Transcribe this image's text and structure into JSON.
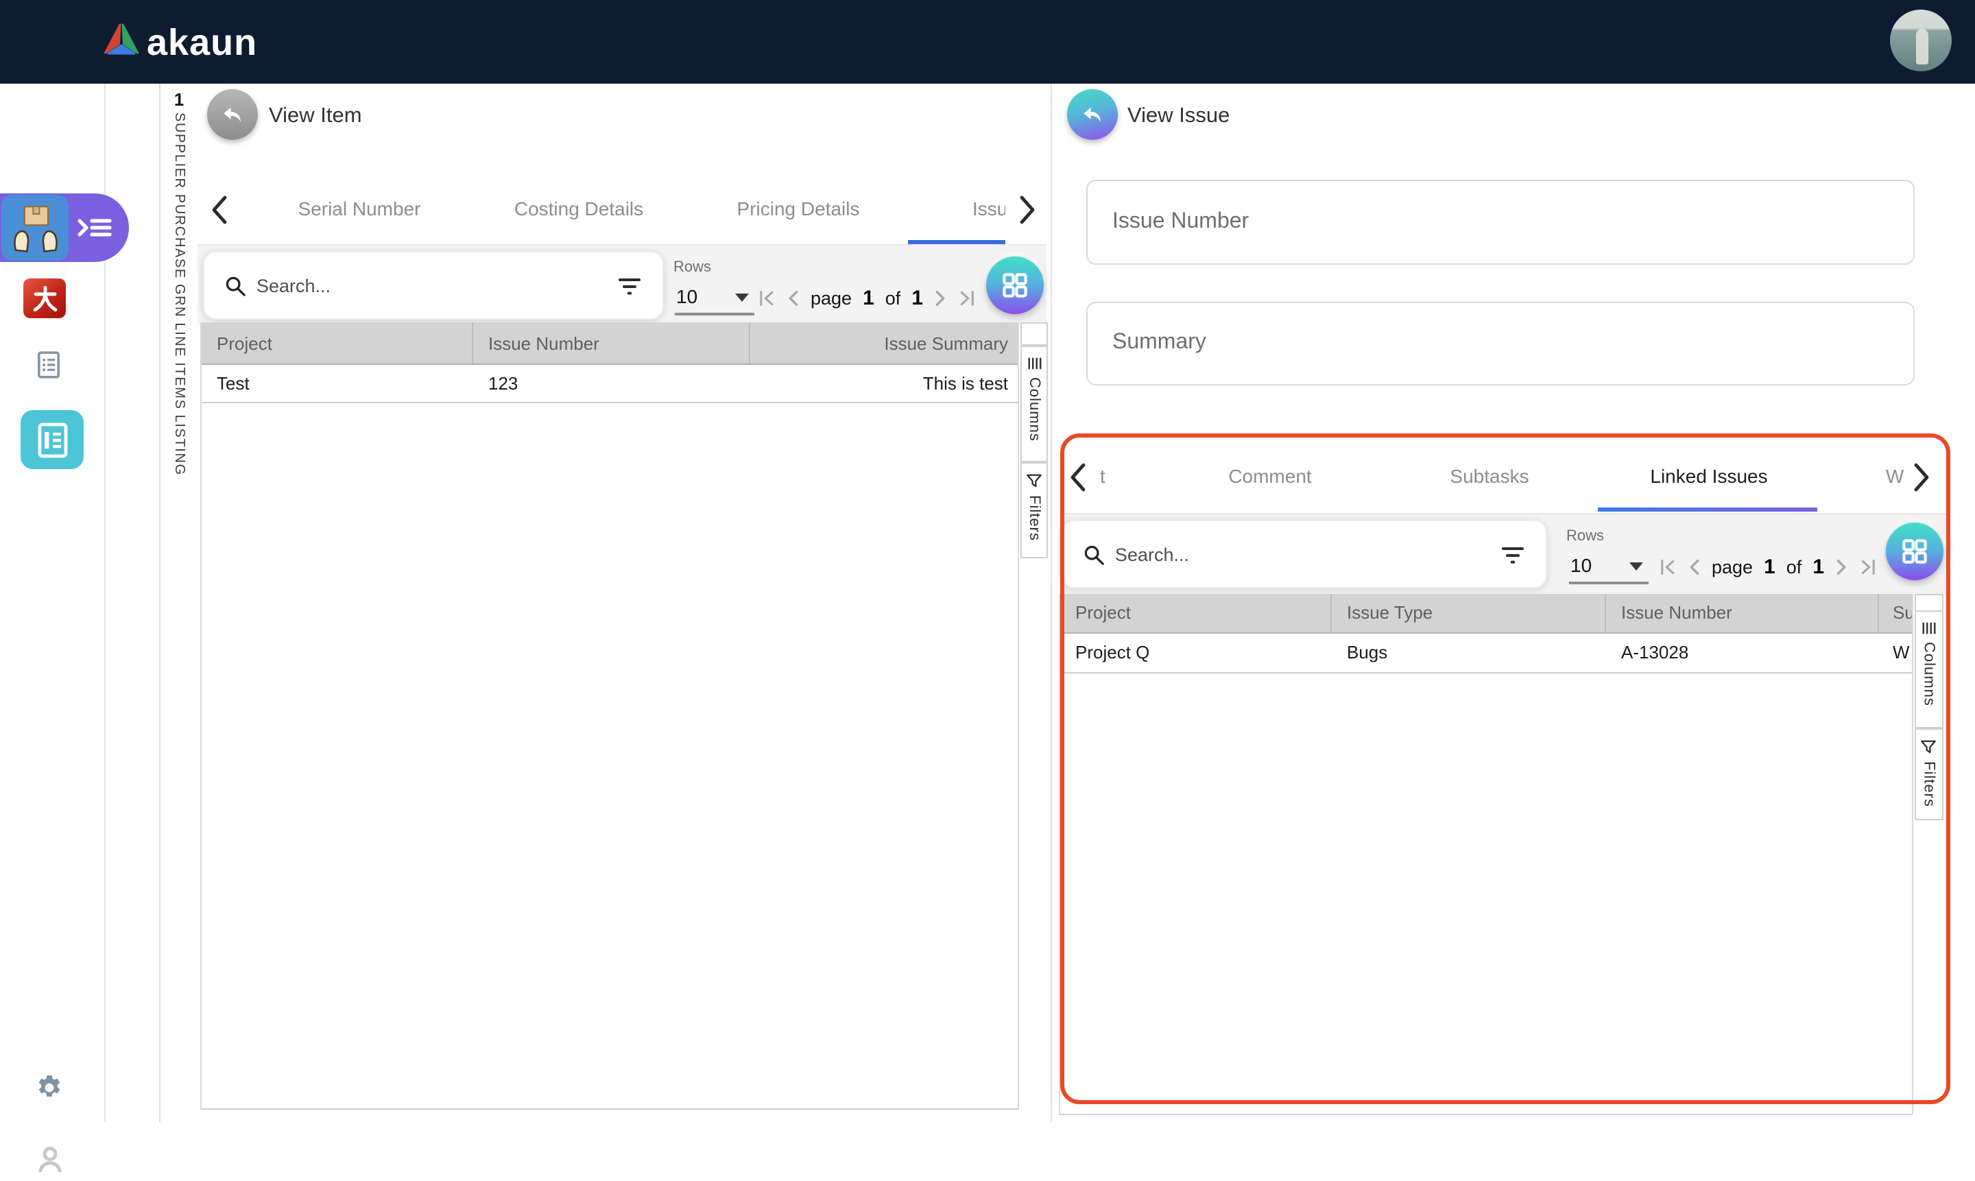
{
  "brand": "akaun",
  "listing_strip": {
    "index": "1",
    "label": "SUPPLIER PURCHASE GRN LINE ITEMS LISTING"
  },
  "left_panel": {
    "title": "View Item",
    "tabs": [
      "Serial Number",
      "Costing Details",
      "Pricing Details",
      "Issu"
    ],
    "toolbar": {
      "search_placeholder": "Search...",
      "rows_label": "Rows",
      "rows_value": "10",
      "page_word": "page",
      "page_current": "1",
      "of_word": "of",
      "page_total": "1"
    },
    "table": {
      "columns": [
        "Project",
        "Issue Number",
        "Issue Summary"
      ],
      "rows": [
        {
          "project": "Test",
          "issue_number": "123",
          "issue_summary": "This is test"
        }
      ]
    },
    "side_tabs": {
      "columns": "Columns",
      "filters": "Filters"
    }
  },
  "right_panel": {
    "title": "View Issue",
    "fields": {
      "issue_number": "Issue Number",
      "summary": "Summary"
    },
    "tabs": [
      "t",
      "Comment",
      "Subtasks",
      "Linked Issues",
      "W"
    ],
    "active_tab": "Linked Issues",
    "toolbar": {
      "search_placeholder": "Search...",
      "rows_label": "Rows",
      "rows_value": "10",
      "page_word": "page",
      "page_current": "1",
      "of_word": "of",
      "page_total": "1"
    },
    "table": {
      "columns": [
        "Project",
        "Issue Type",
        "Issue Number",
        "Su"
      ],
      "rows": [
        {
          "project": "Project Q",
          "issue_type": "Bugs",
          "issue_number": "A-13028",
          "summary": "W"
        }
      ]
    },
    "side_tabs": {
      "columns": "Columns",
      "filters": "Filters"
    }
  },
  "colors": {
    "header_bg": "#0e1c31",
    "highlight_orange": "#ea4a28",
    "underline_blue": "#3b6be0",
    "underline_purple": "#7d5fe0",
    "button_gradient_top": "#3fe2c6",
    "button_gradient_bottom": "#8d4cee"
  }
}
